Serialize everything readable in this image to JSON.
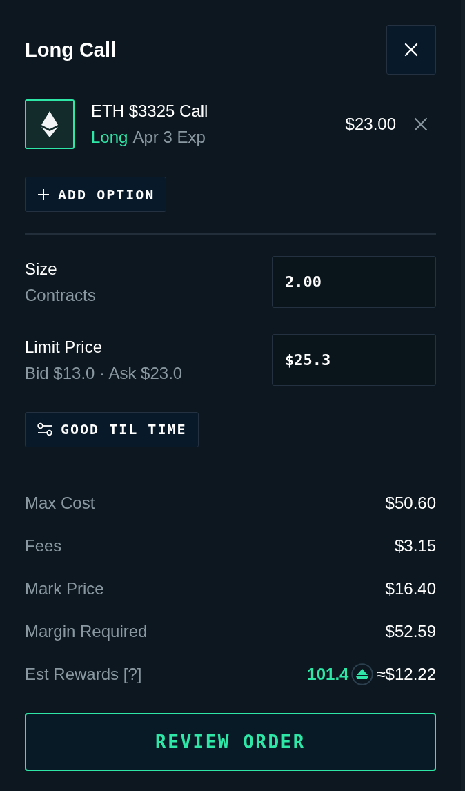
{
  "header": {
    "title": "Long Call"
  },
  "legs": [
    {
      "name": "ETH $3325 Call",
      "kind": "long",
      "side": "Long",
      "expiry": "Apr 3 Exp",
      "price": "$23.00"
    }
  ],
  "add_option_button": {
    "label": "ADD OPTION"
  },
  "fields": [
    {
      "label": "Size",
      "hint": "Contracts",
      "value": "2.00"
    },
    {
      "label": "Limit Price",
      "hint": "Bid $13.0 · Ask $23.0",
      "value": "$25.3"
    }
  ],
  "time_in_force_button": {
    "label": "GOOD TIL TIME"
  },
  "summary": [
    {
      "kind": "plain",
      "label": "Max Cost",
      "value": "$50.60"
    },
    {
      "kind": "plain",
      "label": "Fees",
      "value": "$3.15"
    },
    {
      "kind": "plain",
      "label": "Mark Price",
      "value": "$16.40"
    },
    {
      "kind": "plain",
      "label": "Margin Required",
      "value": "$52.59"
    },
    {
      "kind": "rewards",
      "label": "Est Rewards [?]",
      "points": "101.4",
      "value": "≈$12.22"
    }
  ],
  "submit_button": {
    "label": "REVIEW ORDER"
  }
}
